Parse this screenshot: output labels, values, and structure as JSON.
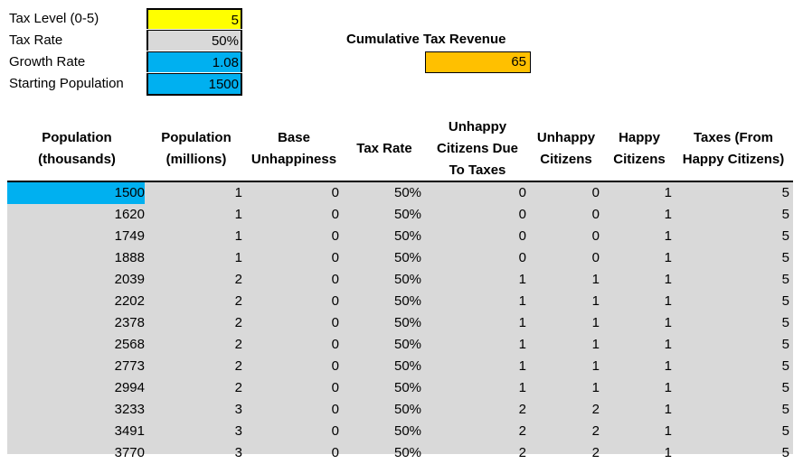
{
  "parameters": [
    {
      "label": "Tax Level (0-5)",
      "value": "5",
      "color": "#ffff00"
    },
    {
      "label": "Tax Rate",
      "value": "50%",
      "color": "#d9d9d9"
    },
    {
      "label": "Growth Rate",
      "value": "1.08",
      "color": "#00b0f0"
    },
    {
      "label": "Starting Population",
      "value": "1500",
      "color": "#00b0f0"
    }
  ],
  "cumulative": {
    "label": "Cumulative Tax Revenue",
    "value": "65",
    "color": "#ffc000"
  },
  "table": {
    "headers": [
      "Population (thousands)",
      "Population (millions)",
      "Base Unhappiness",
      "Tax Rate",
      "Unhappy Citizens Due To Taxes",
      "Unhappy Citizens",
      "Happy Citizens",
      "Taxes (From Happy Citizens)"
    ],
    "header_lines": [
      [
        "Population",
        "(thousands)"
      ],
      [
        "Population",
        "(millions)"
      ],
      [
        "Base",
        "Unhappiness"
      ],
      [
        "Tax Rate"
      ],
      [
        "Unhappy",
        "Citizens Due",
        "To Taxes"
      ],
      [
        "Unhappy",
        "Citizens"
      ],
      [
        "Happy",
        "Citizens"
      ],
      [
        "Taxes (From",
        "Happy Citizens)"
      ]
    ],
    "rows": [
      [
        "1500",
        "1",
        "0",
        "50%",
        "0",
        "0",
        "1",
        "5"
      ],
      [
        "1620",
        "1",
        "0",
        "50%",
        "0",
        "0",
        "1",
        "5"
      ],
      [
        "1749",
        "1",
        "0",
        "50%",
        "0",
        "0",
        "1",
        "5"
      ],
      [
        "1888",
        "1",
        "0",
        "50%",
        "0",
        "0",
        "1",
        "5"
      ],
      [
        "2039",
        "2",
        "0",
        "50%",
        "1",
        "1",
        "1",
        "5"
      ],
      [
        "2202",
        "2",
        "0",
        "50%",
        "1",
        "1",
        "1",
        "5"
      ],
      [
        "2378",
        "2",
        "0",
        "50%",
        "1",
        "1",
        "1",
        "5"
      ],
      [
        "2568",
        "2",
        "0",
        "50%",
        "1",
        "1",
        "1",
        "5"
      ],
      [
        "2773",
        "2",
        "0",
        "50%",
        "1",
        "1",
        "1",
        "5"
      ],
      [
        "2994",
        "2",
        "0",
        "50%",
        "1",
        "1",
        "1",
        "5"
      ],
      [
        "3233",
        "3",
        "0",
        "50%",
        "2",
        "2",
        "1",
        "5"
      ],
      [
        "3491",
        "3",
        "0",
        "50%",
        "2",
        "2",
        "1",
        "5"
      ],
      [
        "3770",
        "3",
        "0",
        "50%",
        "2",
        "2",
        "1",
        "5"
      ]
    ],
    "highlight_color": "#00b0f0",
    "body_color": "#d9d9d9"
  }
}
